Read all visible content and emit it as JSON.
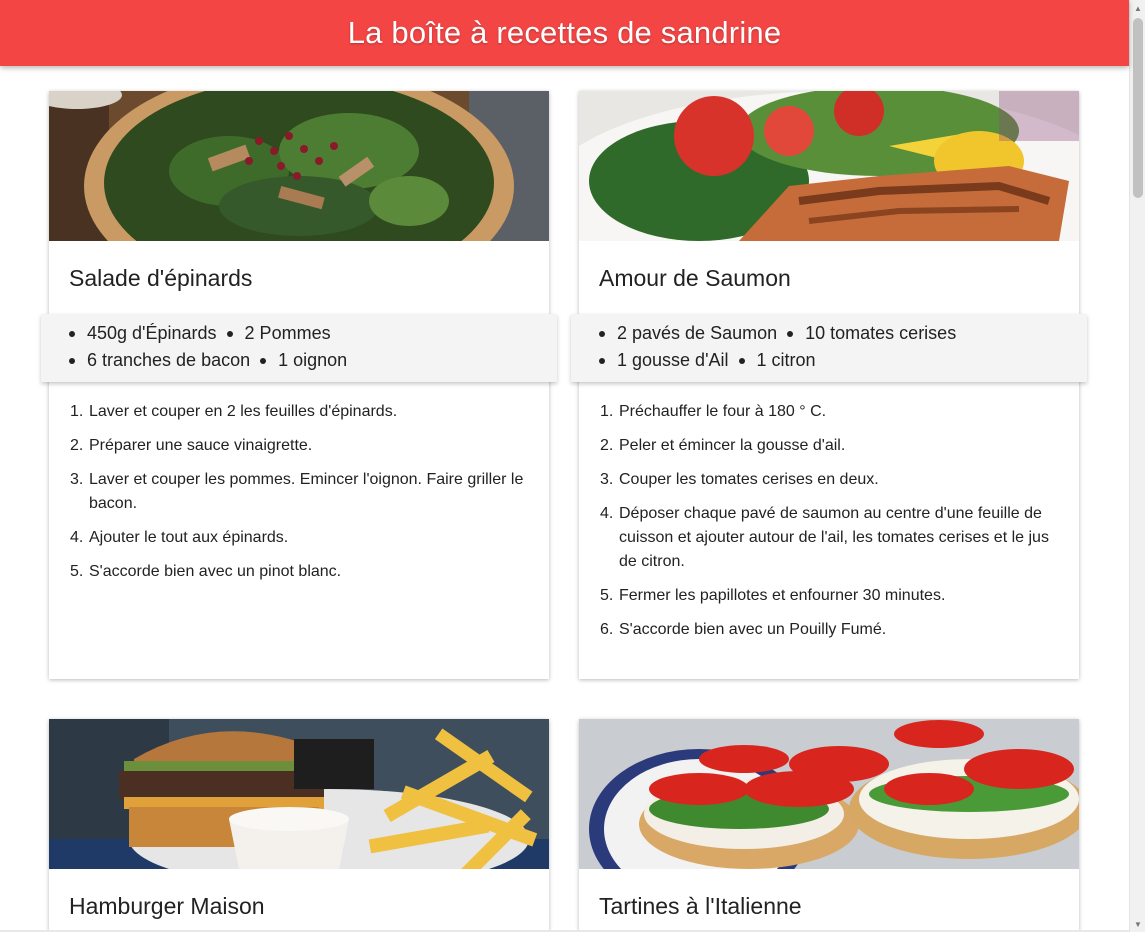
{
  "header": {
    "title": "La boîte à recettes de sandrine",
    "color": "#f44545"
  },
  "recipes": [
    {
      "title": "Salade d'épinards",
      "image_icon": "spinach-salad-photo",
      "ingredients": [
        "450g d'Épinards",
        "2 Pommes",
        "6 tranches de bacon",
        "1 oignon"
      ],
      "steps": [
        "Laver et couper en 2 les feuilles d'épinards.",
        "Préparer une sauce vinaigrette.",
        "Laver et couper les pommes. Emincer l'oignon. Faire griller le bacon.",
        "Ajouter le tout aux épinards.",
        "S'accorde bien avec un pinot blanc."
      ]
    },
    {
      "title": "Amour de Saumon",
      "image_icon": "salmon-plate-photo",
      "ingredients": [
        "2 pavés de Saumon",
        "10 tomates cerises",
        "1 gousse d'Ail",
        "1 citron"
      ],
      "steps": [
        "Préchauffer le four à 180 ° C.",
        "Peler et émincer la gousse d'ail.",
        "Couper les tomates cerises en deux.",
        "Déposer chaque pavé de saumon au centre d'une feuille de cuisson et ajouter autour de l'ail, les tomates cerises et le jus de citron.",
        "Fermer les papillotes et enfourner 30 minutes.",
        "S'accorde bien avec un Pouilly Fumé."
      ]
    },
    {
      "title": "Hamburger Maison",
      "image_icon": "burger-fries-photo"
    },
    {
      "title": "Tartines à l'Italienne",
      "image_icon": "italian-toast-photo"
    }
  ]
}
